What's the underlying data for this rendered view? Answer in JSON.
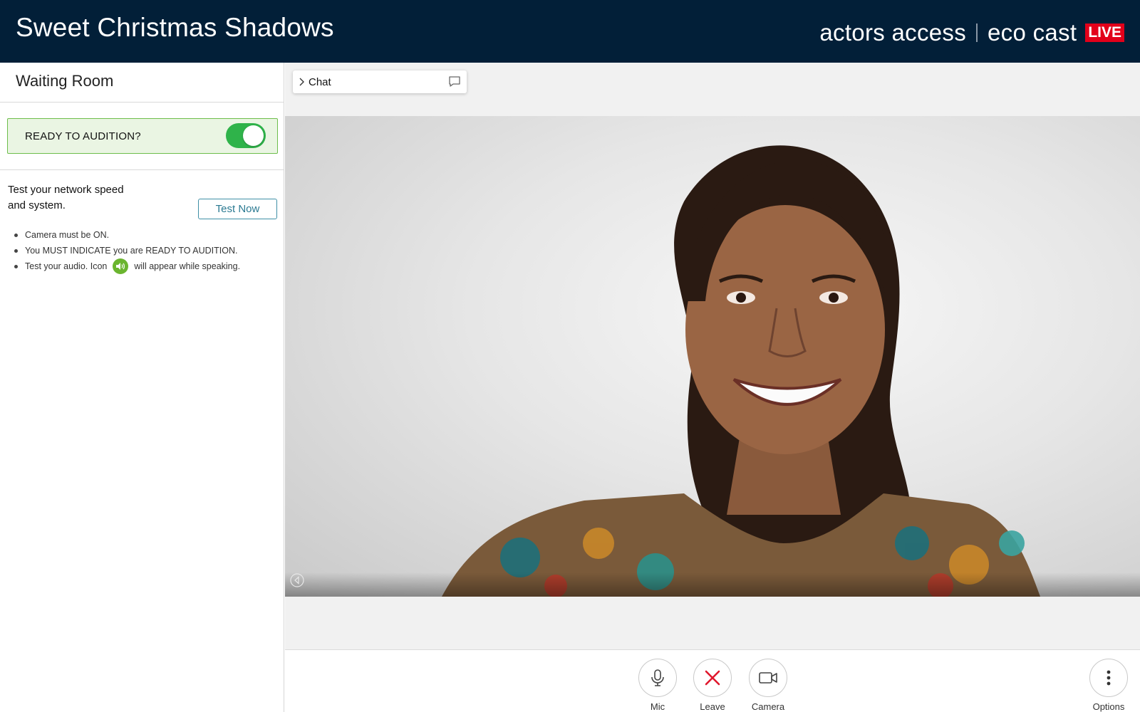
{
  "header": {
    "title": "Sweet Christmas Shadows",
    "brand_left": "actors access",
    "brand_right": "eco cast",
    "brand_badge": "LIVE",
    "colors": {
      "background": "#021f38",
      "badge": "#e2001a"
    }
  },
  "sidebar": {
    "title": "Waiting Room",
    "ready": {
      "label": "READY TO AUDITION?",
      "toggle_on": true,
      "toggle_color": "#2fb34a"
    },
    "network_test": {
      "line1": "Test your network speed",
      "line2": "and system.",
      "button_label": "Test Now"
    },
    "instructions": {
      "item1": "Camera must be ON.",
      "item2": "You MUST INDICATE you are READY TO AUDITION.",
      "item3_before": "Test your audio. Icon",
      "item3_icon": "speaker-icon",
      "item3_after": "will appear while speaking."
    }
  },
  "main": {
    "chat": {
      "label": "Chat",
      "icon": "chat-bubble-icon"
    },
    "video": {
      "subject": "smiling woman video feed"
    },
    "controls": {
      "mic": "Mic",
      "leave": "Leave",
      "camera": "Camera",
      "options": "Options"
    }
  }
}
